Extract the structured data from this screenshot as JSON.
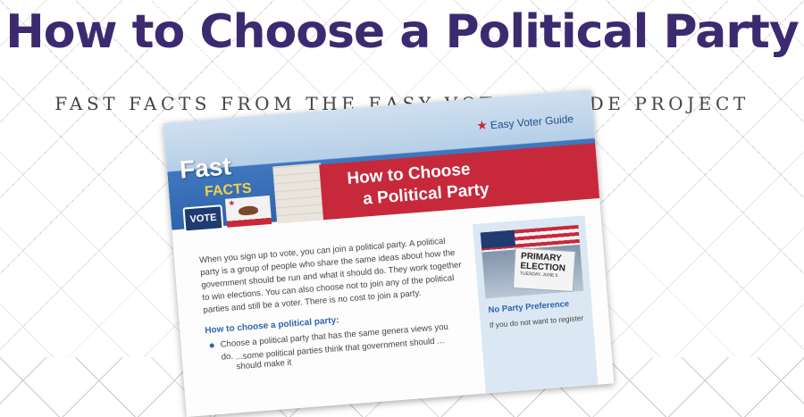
{
  "headline": "How to Choose a Political Party",
  "subheadline": "FAST FACTS FROM THE EASY VOTER GUIDE PROJECT",
  "document": {
    "brand": "Easy Voter Guide",
    "fast_label": "Fast",
    "facts_label": "FACTS",
    "banner_line_1": "How to Choose",
    "banner_line_2": "a Political Party",
    "vote_sign_text": "VOTE",
    "intro_paragraph": "When you sign up to vote, you can join a political party. A political party is a group of people who share the same ideas about how the government should be run and what it should do. They work together to win elections. You can also choose not to join any of the political parties and still be a voter. There is no cost to join a party.",
    "section_heading": "How to choose a political party:",
    "bullet_1": "Choose a political party that has the same genera  views you do.",
    "bullet_1_tail": "...some political parties think that government should ... should make it",
    "sidebar": {
      "photo_title": "PRIMARY ELECTION",
      "photo_subtitle": "TUESDAY, JUNE 5",
      "heading": "No Party Preference",
      "text": "If you do not want to register"
    }
  },
  "colors": {
    "headline": "#3c2a70",
    "banner_red": "#c7293b",
    "accent_blue": "#2f64ad",
    "sidebar_bg": "#dbe8f4"
  }
}
